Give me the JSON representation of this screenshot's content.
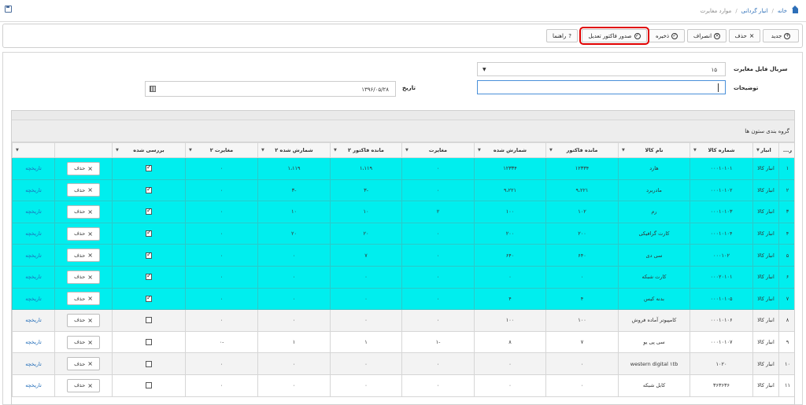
{
  "breadcrumb": {
    "home": "خانه",
    "inventory": "انبار گردانی",
    "current": "موارد مغایرت"
  },
  "toolbar": {
    "new": "جدید",
    "delete": "حذف",
    "cancel": "انصراف",
    "save": "ذخیره",
    "issue": "صدور فاکتور تعدیل",
    "help": "راهنما"
  },
  "form": {
    "serial_label": "سریال فایل مغایرت",
    "serial_value": "۱۵",
    "desc_label": "توضیحات",
    "date_label": "تاریخ",
    "date_value": "۱۳۹۶/۰۵/۲۸"
  },
  "grid": {
    "group_hint": "گروه بندی ستون ها",
    "columns": [
      "ر...",
      "انبار",
      "شماره کالا",
      "نام کالا",
      "مانده فاکتور",
      "شمارش شده",
      "مغایرت",
      "مانده فاکتور ۲",
      "شمارش شده ۲",
      "مغایرت ۲",
      "بررسی شده",
      "",
      ""
    ],
    "delete_label": "حذف",
    "history_label": "تاریخچه",
    "rows": [
      {
        "n": "۱",
        "wh": "انبار کالا",
        "code": "۰۰۰۱۰۱۰۱",
        "name": "هارد",
        "rem": "۱۲۳۳۴",
        "cnt": "۱۲۳۳۴",
        "diff": "۰",
        "rem2": "۱،۱۱۹",
        "cnt2": "۱،۱۱۹",
        "diff2": "۰",
        "checked": true,
        "sel": true
      },
      {
        "n": "۲",
        "wh": "انبار کالا",
        "code": "۰۰۰۱۰۱۰۲",
        "name": "مادربرد",
        "rem": "۹،۲۲۱",
        "cnt": "۹،۲۲۱",
        "diff": "۰",
        "rem2": "-۳",
        "cnt2": "-۳",
        "diff2": "۰",
        "checked": true,
        "sel": true
      },
      {
        "n": "۳",
        "wh": "انبار کالا",
        "code": "۰۰۰۱۰۱۰۳",
        "name": "رم",
        "rem": "۱۰۲",
        "cnt": "۱۰۰",
        "diff": "۲",
        "rem2": "۱۰",
        "cnt2": "۱۰",
        "diff2": "۰",
        "checked": true,
        "sel": true
      },
      {
        "n": "۴",
        "wh": "انبار کالا",
        "code": "۰۰۰۱۰۱۰۴",
        "name": "کارت گرافیکی",
        "rem": "۲۰۰",
        "cnt": "۲۰۰",
        "diff": "۰",
        "rem2": "۲۰",
        "cnt2": "۲۰",
        "diff2": "۰",
        "checked": true,
        "sel": true
      },
      {
        "n": "۵",
        "wh": "انبار کالا",
        "code": "۰۰۰۱۰۲",
        "name": "سی دی",
        "rem": "۶۴۰",
        "cnt": "۶۴۰",
        "diff": "۰",
        "rem2": "۷",
        "cnt2": "۰",
        "diff2": "۰",
        "checked": true,
        "sel": true
      },
      {
        "n": "۶",
        "wh": "انبار کالا",
        "code": "۰۰۰۲۰۱۰۱",
        "name": "کارت شبکه",
        "rem": "۰",
        "cnt": "۰",
        "diff": "۰",
        "rem2": "۰",
        "cnt2": "۰",
        "diff2": "۰",
        "checked": true,
        "sel": true
      },
      {
        "n": "۷",
        "wh": "انبار کالا",
        "code": "۰۰۰۱۰۱۰۵",
        "name": "بدنه کیس",
        "rem": "۴",
        "cnt": "۴",
        "diff": "۰",
        "rem2": "۰",
        "cnt2": "۰",
        "diff2": "۰",
        "checked": true,
        "sel": true
      },
      {
        "n": "۸",
        "wh": "انبار کالا",
        "code": "۰۰۰۱۰۱۰۶",
        "name": "کامپیوتر آماده فروش",
        "rem": "۱۰۰",
        "cnt": "۱۰۰",
        "diff": "۰",
        "rem2": "۰",
        "cnt2": "۰",
        "diff2": "۰",
        "checked": false,
        "sel": false
      },
      {
        "n": "۹",
        "wh": "انبار کالا",
        "code": "۰۰۰۱۰۱۰۷",
        "name": "سی پی یو",
        "rem": "۷",
        "cnt": "۸",
        "diff": "-۱",
        "rem2": "۱",
        "cnt2": "۱",
        "diff2": "-۰",
        "checked": false,
        "sel": false
      },
      {
        "n": "۱۰",
        "wh": "انبار کالا",
        "code": "۱۰۲۰",
        "name": "western digital ۱tb",
        "rem": "۰",
        "cnt": "۰",
        "diff": "۰",
        "rem2": "۰",
        "cnt2": "۰",
        "diff2": "۰",
        "checked": false,
        "sel": false
      },
      {
        "n": "۱۱",
        "wh": "انبار کالا",
        "code": "۳۶۳۶۳۶",
        "name": "کابل شبکه",
        "rem": "۰",
        "cnt": "۰",
        "diff": "۰",
        "rem2": "۰",
        "cnt2": "۰",
        "diff2": "۰",
        "checked": false,
        "sel": false
      }
    ]
  },
  "colors": {
    "selected_row": "#00eeee",
    "link": "#1f6bb8",
    "highlight": "#e00000"
  }
}
